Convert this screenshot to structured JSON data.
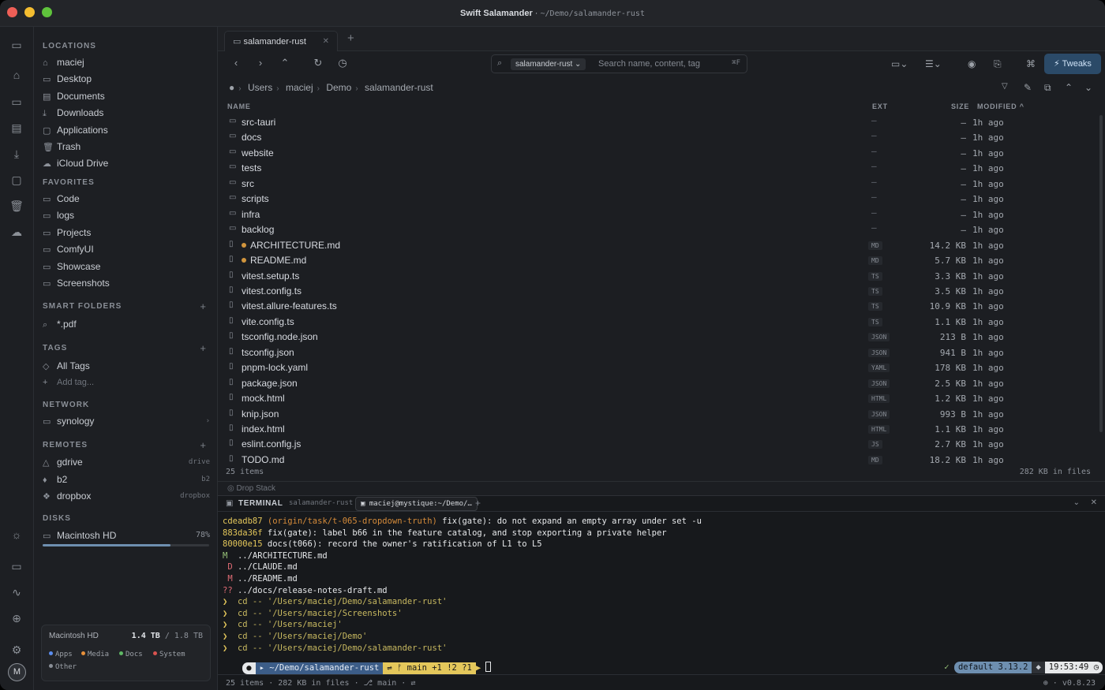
{
  "window": {
    "app": "Swift Salamander",
    "path": "~/Demo/salamander-rust"
  },
  "sidebar": {
    "locations_h": "LOCATIONS",
    "locations": [
      {
        "label": "maciej",
        "icon": "home-icon"
      },
      {
        "label": "Desktop",
        "icon": "desktop-icon"
      },
      {
        "label": "Documents",
        "icon": "doc-icon"
      },
      {
        "label": "Downloads",
        "icon": "download-icon"
      },
      {
        "label": "Applications",
        "icon": "apps-icon"
      },
      {
        "label": "Trash",
        "icon": "trash-icon"
      },
      {
        "label": "iCloud Drive",
        "icon": "cloud-icon"
      }
    ],
    "favorites_h": "FAVORITES",
    "favorites": [
      "Code",
      "logs",
      "Projects",
      "ComfyUI",
      "Showcase",
      "Screenshots"
    ],
    "smart_h": "SMART FOLDERS",
    "smart": [
      "*.pdf"
    ],
    "tags_h": "TAGS",
    "tags": [
      "All Tags"
    ],
    "add_tag": "Add tag...",
    "network_h": "NETWORK",
    "network": [
      "synology"
    ],
    "remotes_h": "REMOTES",
    "remotes": [
      {
        "label": "gdrive",
        "type": "drive"
      },
      {
        "label": "b2",
        "type": "b2"
      },
      {
        "label": "dropbox",
        "type": "dropbox"
      }
    ],
    "disks_h": "DISKS",
    "disk": {
      "label": "Macintosh HD",
      "pct": "78%",
      "fill": 0.78
    },
    "storage": {
      "name": "Macintosh HD",
      "used": "1.4 TB",
      "total": "/ 1.8 TB",
      "legend": [
        {
          "l": "Apps",
          "c": "#5b8def"
        },
        {
          "l": "Media",
          "c": "#e8903a"
        },
        {
          "l": "Docs",
          "c": "#5fb865"
        },
        {
          "l": "System",
          "c": "#d9534f"
        },
        {
          "l": "Other",
          "c": "#8a8f97"
        }
      ]
    },
    "avatar": "M"
  },
  "tab": {
    "label": "salamander-rust"
  },
  "search": {
    "scope": "salamander-rust",
    "placeholder": "Search name, content, tag",
    "kbd": "⌘F"
  },
  "toolbar": {
    "tweaks": "Tweaks"
  },
  "breadcrumb": [
    "Users",
    "maciej",
    "Demo",
    "salamander-rust"
  ],
  "columns": {
    "name": "NAME",
    "ext": "EXT",
    "size": "SIZE",
    "modified": "MODIFIED ^"
  },
  "files": [
    {
      "n": "src-tauri",
      "dir": true,
      "e": "—",
      "s": "–",
      "m": "1h ago"
    },
    {
      "n": "docs",
      "dir": true,
      "e": "—",
      "s": "–",
      "m": "1h ago"
    },
    {
      "n": "website",
      "dir": true,
      "e": "—",
      "s": "–",
      "m": "1h ago"
    },
    {
      "n": "tests",
      "dir": true,
      "e": "—",
      "s": "–",
      "m": "1h ago"
    },
    {
      "n": "src",
      "dir": true,
      "e": "—",
      "s": "–",
      "m": "1h ago"
    },
    {
      "n": "scripts",
      "dir": true,
      "e": "—",
      "s": "–",
      "m": "1h ago"
    },
    {
      "n": "infra",
      "dir": true,
      "e": "—",
      "s": "–",
      "m": "1h ago"
    },
    {
      "n": "backlog",
      "dir": true,
      "e": "—",
      "s": "–",
      "m": "1h ago"
    },
    {
      "n": "ARCHITECTURE.md",
      "dot": true,
      "e": "MD",
      "s": "14.2 KB",
      "m": "1h ago"
    },
    {
      "n": "README.md",
      "dot": true,
      "e": "MD",
      "s": "5.7 KB",
      "m": "1h ago"
    },
    {
      "n": "vitest.setup.ts",
      "e": "TS",
      "s": "3.3 KB",
      "m": "1h ago"
    },
    {
      "n": "vitest.config.ts",
      "e": "TS",
      "s": "3.5 KB",
      "m": "1h ago"
    },
    {
      "n": "vitest.allure-features.ts",
      "e": "TS",
      "s": "10.9 KB",
      "m": "1h ago"
    },
    {
      "n": "vite.config.ts",
      "e": "TS",
      "s": "1.1 KB",
      "m": "1h ago"
    },
    {
      "n": "tsconfig.node.json",
      "e": "JSON",
      "s": "213 B",
      "m": "1h ago"
    },
    {
      "n": "tsconfig.json",
      "e": "JSON",
      "s": "941 B",
      "m": "1h ago"
    },
    {
      "n": "pnpm-lock.yaml",
      "e": "YAML",
      "s": "178 KB",
      "m": "1h ago"
    },
    {
      "n": "package.json",
      "e": "JSON",
      "s": "2.5 KB",
      "m": "1h ago"
    },
    {
      "n": "mock.html",
      "e": "HTML",
      "s": "1.2 KB",
      "m": "1h ago"
    },
    {
      "n": "knip.json",
      "e": "JSON",
      "s": "993 B",
      "m": "1h ago"
    },
    {
      "n": "index.html",
      "e": "HTML",
      "s": "1.1 KB",
      "m": "1h ago"
    },
    {
      "n": "eslint.config.js",
      "e": "JS",
      "s": "2.7 KB",
      "m": "1h ago"
    },
    {
      "n": "TODO.md",
      "e": "MD",
      "s": "18.2 KB",
      "m": "1h ago"
    }
  ],
  "footer": {
    "items": "25 items",
    "size": "282 KB in files",
    "drop": "Drop Stack"
  },
  "terminal": {
    "title": "TERMINAL",
    "cwd": "salamander-rust",
    "session": "maciej@mystique:~/Demo/…",
    "lines": [
      [
        [
          "y",
          "cdeadb87 "
        ],
        [
          "o",
          "(origin/task/t-065-dropdown-truth)"
        ],
        [
          "",
          ""
        ],
        [
          "w",
          " fix(gate): do not expand an empty array under set -u"
        ]
      ],
      [
        [
          "y",
          "883da36f "
        ],
        [
          "w",
          "fix(gate): label b66 in the feature catalog, and stop exporting a private helper"
        ]
      ],
      [
        [
          "y",
          "80000e15 "
        ],
        [
          "w",
          "docs(t066): record the owner's ratification of L1 to L5"
        ]
      ],
      [
        [
          "g",
          "M  "
        ],
        [
          "w",
          "../ARCHITECTURE.md"
        ]
      ],
      [
        [
          "r",
          " D "
        ],
        [
          "w",
          "../CLAUDE.md"
        ]
      ],
      [
        [
          "r",
          " M "
        ],
        [
          "w",
          "../README.md"
        ]
      ],
      [
        [
          "r",
          "?? "
        ],
        [
          "w",
          "../docs/release-notes-draft.md"
        ]
      ],
      [
        [
          "y",
          "❯  "
        ],
        [
          "cy",
          "cd -- '/Users/maciej/Demo/salamander-rust'"
        ]
      ],
      [
        [
          "y",
          "❯  "
        ],
        [
          "cy",
          "cd -- '/Users/maciej/Screenshots'"
        ]
      ],
      [
        [
          "y",
          "❯  "
        ],
        [
          "cy",
          "cd -- '/Users/maciej'"
        ]
      ],
      [
        [
          "y",
          "❯  "
        ],
        [
          "cy",
          "cd -- '/Users/maciej/Demo'"
        ]
      ],
      [
        [
          "y",
          "❯  "
        ],
        [
          "cy",
          "cd -- '/Users/maciej/Demo/salamander-rust'"
        ]
      ]
    ],
    "prompt_dir": "~/Demo/salamander-rust",
    "prompt_git": "main +1 !2 ?1",
    "env": "default 3.13.2",
    "time": "19:53:49",
    "status_items": "25 items",
    "status_size": "282 KB in files",
    "status_branch": "main",
    "version": "v0.8.23"
  }
}
